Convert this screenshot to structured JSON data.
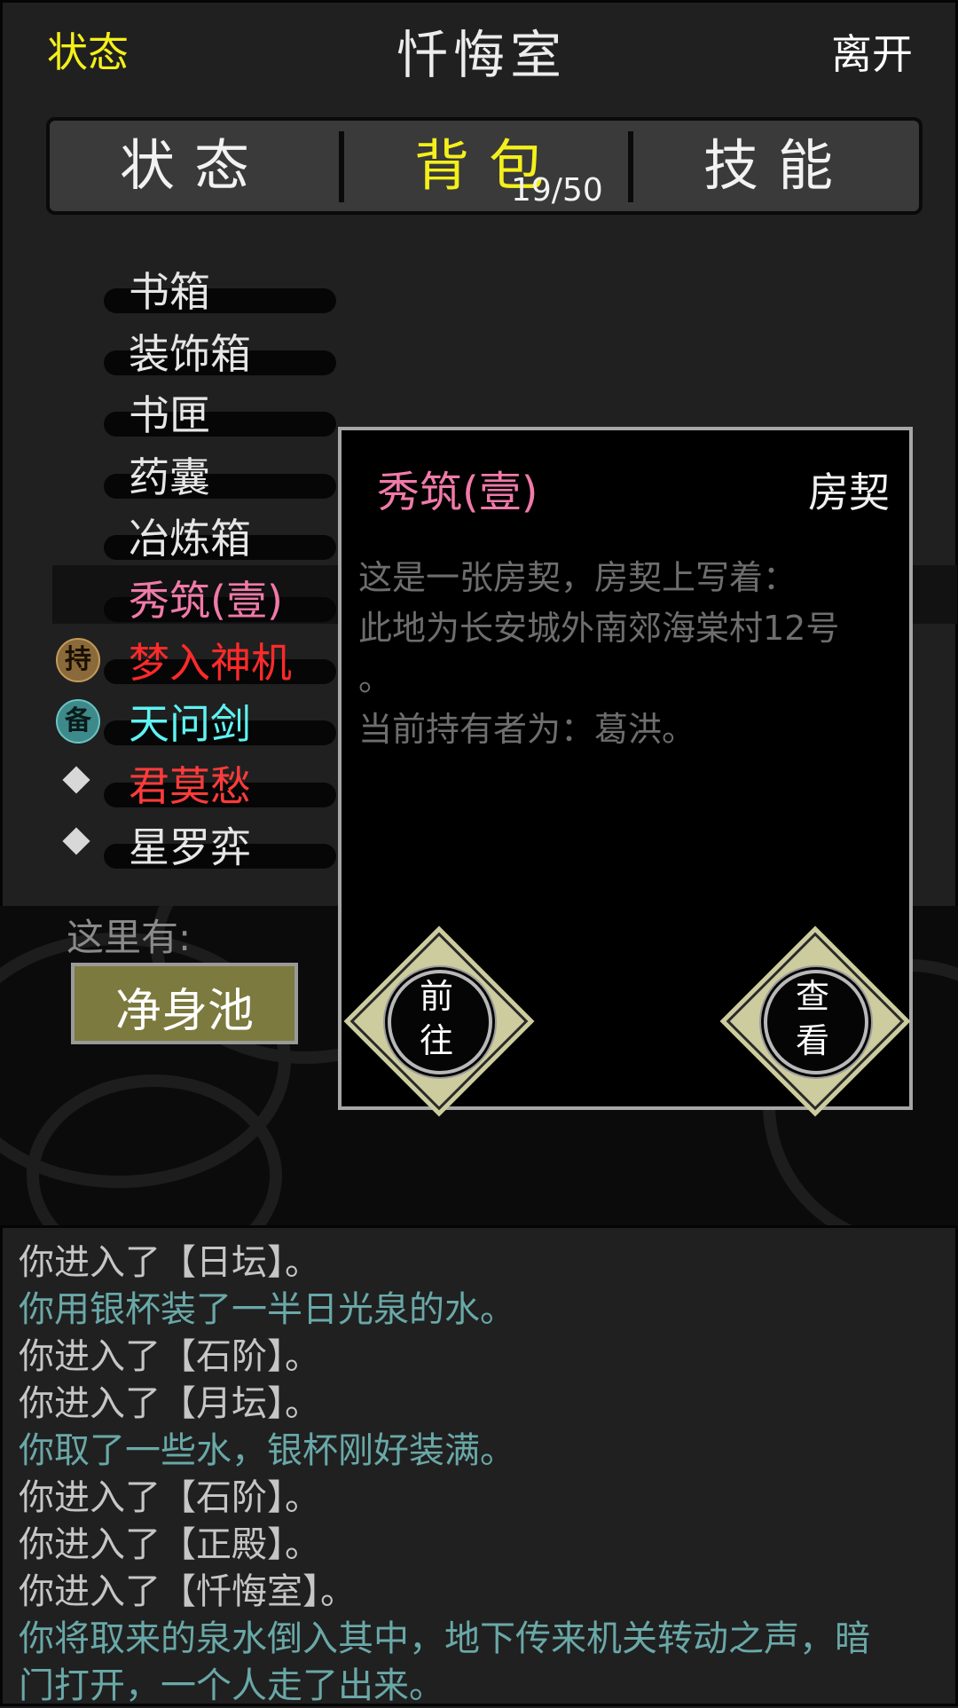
{
  "header": {
    "left_label": "状态",
    "title": "忏悔室",
    "right_label": "离开"
  },
  "tabs": [
    {
      "label": "状态",
      "active": false
    },
    {
      "label": "背包",
      "active": true
    },
    {
      "label": "技能",
      "active": false
    }
  ],
  "inventory_count": "19/50",
  "items": [
    {
      "name": "书箱",
      "color": "#e6e6e6",
      "marker": ""
    },
    {
      "name": "装饰箱",
      "color": "#e6e6e6",
      "marker": ""
    },
    {
      "name": "书匣",
      "color": "#e6e6e6",
      "marker": ""
    },
    {
      "name": "药囊",
      "color": "#e6e6e6",
      "marker": ""
    },
    {
      "name": "冶炼箱",
      "color": "#e6e6e6",
      "marker": ""
    },
    {
      "name": "秀筑(壹)",
      "color": "#f07aa8",
      "marker": "",
      "selected": true
    },
    {
      "name": "梦入神机",
      "color": "#ff2a2a",
      "marker": "持"
    },
    {
      "name": "天问剑",
      "color": "#5ff2f2",
      "marker": "备"
    },
    {
      "name": "君莫愁",
      "color": "#ff3b3b",
      "marker": "diamond"
    },
    {
      "name": "星罗弈",
      "color": "#e6e6e6",
      "marker": "diamond"
    }
  ],
  "scene": {
    "here_label": "这里有:",
    "objects": [
      "净身池"
    ]
  },
  "popup": {
    "item_name": "秀筑(壹)",
    "item_type": "房契",
    "description": [
      "这是一张房契，房契上写着：",
      "此地为长安城外南郊海棠村12号",
      "。",
      "当前持有者为：葛洪。"
    ],
    "btn_goto": [
      "前",
      "往"
    ],
    "btn_view": [
      "查",
      "看"
    ]
  },
  "log": [
    {
      "text": "你进入了【日坛】。",
      "style": "plain"
    },
    {
      "text": "你用银杯装了一半日光泉的水。",
      "style": "cyan"
    },
    {
      "text": "你进入了【石阶】。",
      "style": "plain"
    },
    {
      "text": "你进入了【月坛】。",
      "style": "plain"
    },
    {
      "text": "你取了一些水，银杯刚好装满。",
      "style": "cyan"
    },
    {
      "text": "你进入了【石阶】。",
      "style": "plain"
    },
    {
      "text": "你进入了【正殿】。",
      "style": "plain"
    },
    {
      "text": "你进入了【忏悔室】。",
      "style": "plain"
    },
    {
      "text": "你将取来的泉水倒入其中，地下传来机关转动之声，暗",
      "style": "cyan"
    },
    {
      "text": "门打开，一个人走了出来。",
      "style": "cyan"
    }
  ]
}
